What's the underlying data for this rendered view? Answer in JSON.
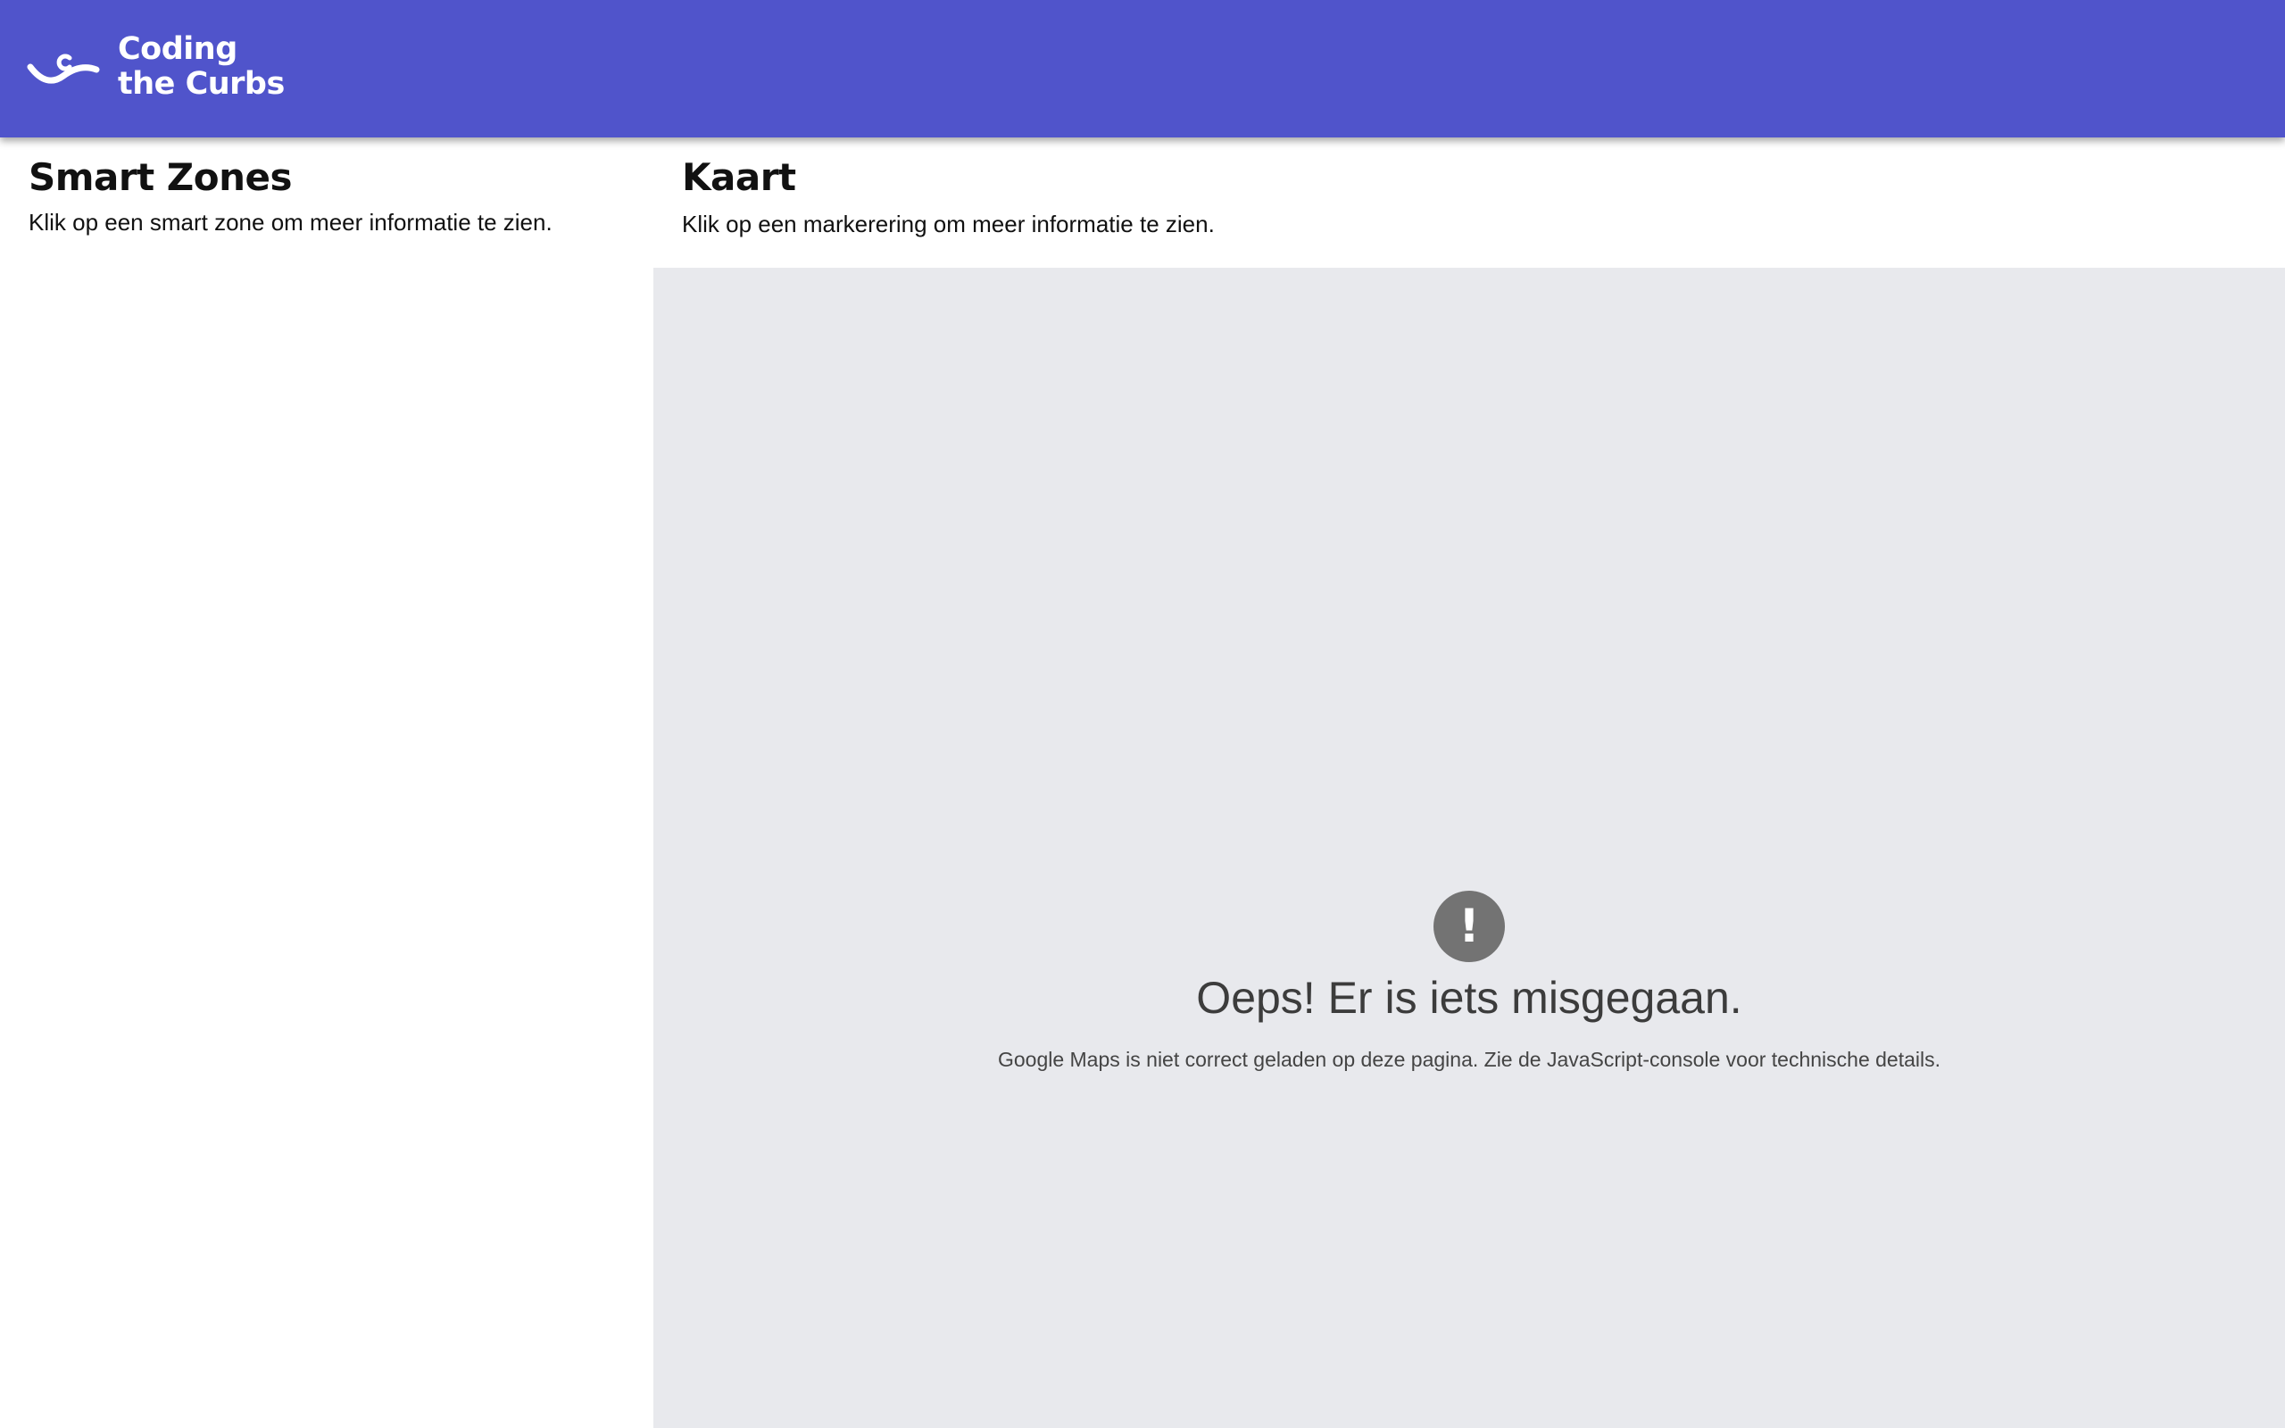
{
  "colors": {
    "header_bg": "#5054cb",
    "map_bg": "#e8e9ed",
    "error_icon_bg": "#737373"
  },
  "header": {
    "brand_line1": "Coding",
    "brand_line2": "the Curbs",
    "logo_icon": "coding-the-curbs-logo"
  },
  "sidebar": {
    "title": "Smart Zones",
    "subtitle": "Klik op een smart zone om meer informatie te zien."
  },
  "map": {
    "title": "Kaart",
    "subtitle": "Klik op een markerering om meer informatie te zien.",
    "error": {
      "icon": "exclamation-icon",
      "icon_glyph": "!",
      "title": "Oeps! Er is iets misgegaan.",
      "message": "Google Maps is niet correct geladen op deze pagina. Zie de JavaScript-console voor technische details."
    }
  }
}
